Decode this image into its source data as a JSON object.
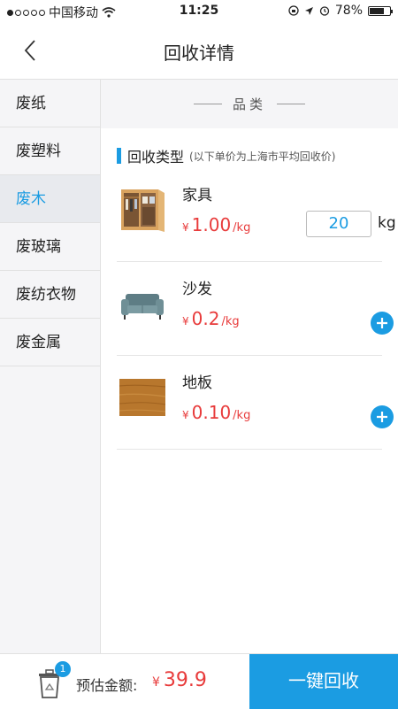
{
  "status_bar": {
    "carrier": "中国移动",
    "time": "11:25",
    "battery": "78%",
    "battery_level": 0.78
  },
  "nav": {
    "title": "回收详情"
  },
  "sidebar": {
    "items": [
      {
        "label": "废纸",
        "active": false
      },
      {
        "label": "废塑料",
        "active": false
      },
      {
        "label": "废木",
        "active": true
      },
      {
        "label": "废玻璃",
        "active": false
      },
      {
        "label": "废纺衣物",
        "active": false
      },
      {
        "label": "废金属",
        "active": false
      }
    ]
  },
  "content": {
    "category_header": "品类",
    "type_title": "回收类型",
    "type_note": "(以下单价为上海市平均回收价)",
    "items": [
      {
        "name": "家具",
        "currency": "¥",
        "price": "1.00",
        "unit": "/kg",
        "quantity": "20",
        "qty_unit": "kg",
        "icon": "wardrobe-icon"
      },
      {
        "name": "沙发",
        "currency": "¥",
        "price": "0.2",
        "unit": "/kg",
        "icon": "sofa-icon"
      },
      {
        "name": "地板",
        "currency": "¥",
        "price": "0.10",
        "unit": "/kg",
        "icon": "wood-floor-icon"
      }
    ]
  },
  "bottom": {
    "badge_count": "1",
    "estimate_label": "预估金额:",
    "currency": "¥",
    "estimate_amount": "39.9",
    "recycle_button": "一键回收"
  },
  "colors": {
    "accent": "#1b9ce2",
    "price": "#e83b3b",
    "sidebar_bg": "#f5f5f7"
  }
}
